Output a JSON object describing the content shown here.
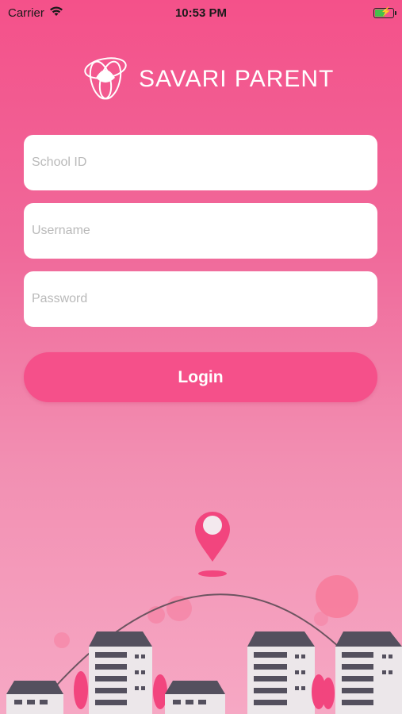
{
  "status_bar": {
    "carrier": "Carrier",
    "time": "10:53 PM",
    "icons": [
      "wifi-icon",
      "battery-charging-icon"
    ]
  },
  "brand": {
    "title": "SAVARI PARENT",
    "logo_icon": "savari-logo-icon"
  },
  "form": {
    "school_id_placeholder": "School ID",
    "username_placeholder": "Username",
    "password_placeholder": "Password",
    "school_id_value": "",
    "username_value": "",
    "password_value": ""
  },
  "login_button": {
    "label": "Login"
  },
  "colors": {
    "primary": "#f5508a",
    "background_top": "#f4518a",
    "background_bottom": "#f6a8c4",
    "building": "#e8e3e6",
    "roof": "#54505e"
  }
}
